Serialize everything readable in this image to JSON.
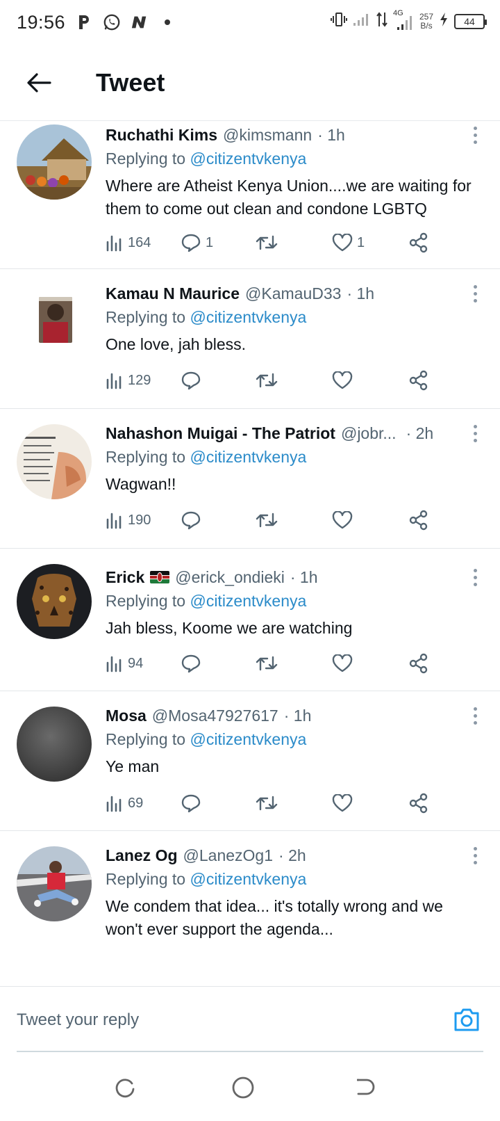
{
  "status_bar": {
    "time": "19:56",
    "net_speed_value": "257",
    "net_speed_unit": "B/s",
    "network_type": "4G",
    "battery": "44",
    "icons": [
      "parking-icon",
      "whatsapp-icon",
      "n-app-icon",
      "dot-icon",
      "vibrate-icon",
      "signal-icon",
      "data-arrows-icon",
      "signal-4g-icon",
      "charging-icon",
      "battery-icon"
    ]
  },
  "header": {
    "title": "Tweet"
  },
  "replying_prefix": "Replying to",
  "tweets": [
    {
      "name": "Ruchathi Kims",
      "handle": "@kimsmann",
      "time": "· 1h",
      "reply_to": "@citizentvkenya",
      "text": "Where are Atheist Kenya Union....we are waiting for them to come out clean and condone LGBTQ",
      "views": "164",
      "replies": "1",
      "retweets": "",
      "likes": "1"
    },
    {
      "name": "Kamau N Maurice",
      "handle": "@KamauD33",
      "time": "· 1h",
      "reply_to": "@citizentvkenya",
      "text": "One love, jah bless.",
      "views": "129",
      "replies": "",
      "retweets": "",
      "likes": ""
    },
    {
      "name": "Nahashon Muigai - The Patriot",
      "handle": "@jobr...",
      "time": "· 2h",
      "reply_to": "@citizentvkenya",
      "text": "Wagwan!!",
      "views": "190",
      "replies": "",
      "retweets": "",
      "likes": ""
    },
    {
      "name": "Erick",
      "handle": "@erick_ondieki",
      "time": "· 1h",
      "reply_to": "@citizentvkenya",
      "text": "Jah bless, Koome we are watching",
      "views": "94",
      "replies": "",
      "retweets": "",
      "likes": ""
    },
    {
      "name": "Mosa",
      "handle": "@Mosa47927617",
      "time": "· 1h",
      "reply_to": "@citizentvkenya",
      "text": "Ye man",
      "views": "69",
      "replies": "",
      "retweets": "",
      "likes": ""
    },
    {
      "name": "Lanez Og",
      "handle": "@LanezOg1",
      "time": "· 2h",
      "reply_to": "@citizentvkenya",
      "text": "We condem that idea... it's  totally wrong and we won't  ever support the agenda...",
      "views": "",
      "replies": "",
      "retweets": "",
      "likes": ""
    }
  ],
  "reply_bar": {
    "placeholder": "Tweet your reply"
  },
  "colors": {
    "mention": "#2b8bc9",
    "muted": "#536471",
    "text": "#0f1419",
    "accent": "#1d9bf0"
  }
}
